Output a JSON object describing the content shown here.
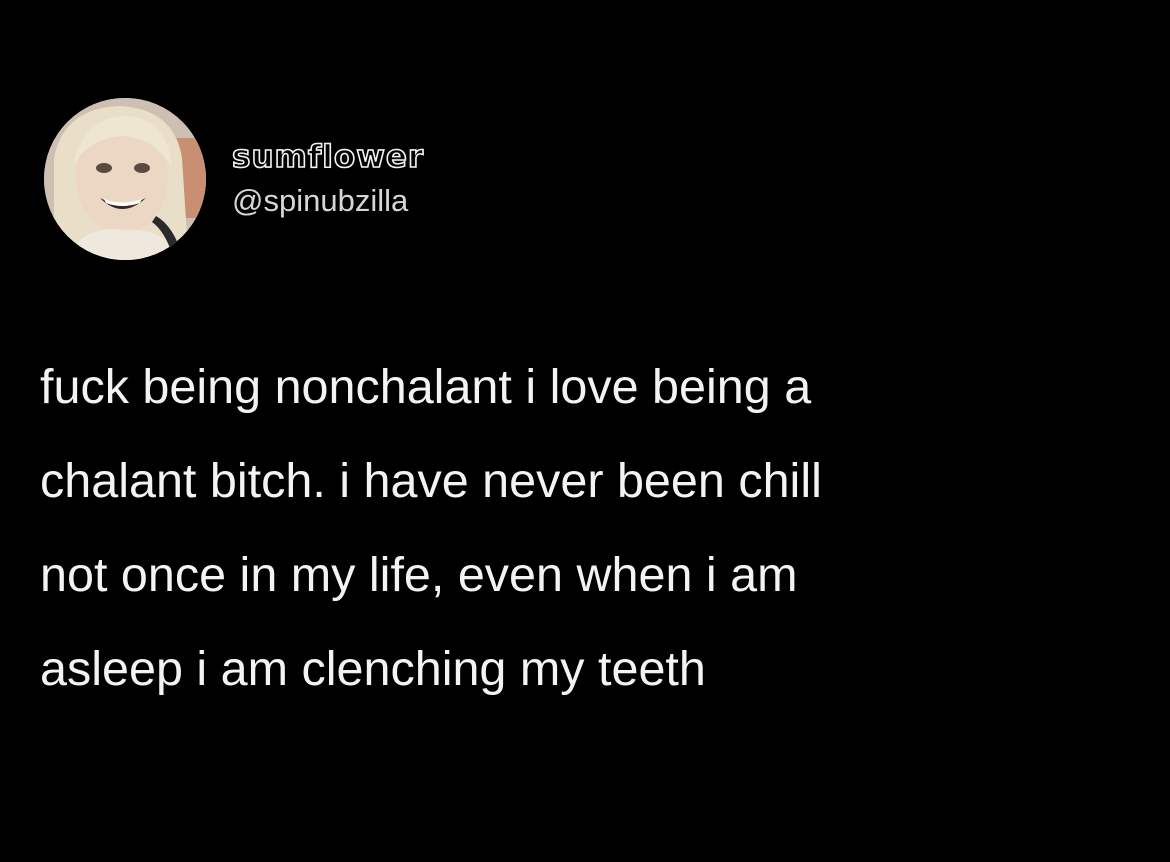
{
  "tweet": {
    "display_name": "sumflower",
    "handle": "@spinubzilla",
    "avatar_icon": "profile-photo",
    "text_lines": [
      "fuck being nonchalant i love being a",
      "chalant bitch. i have never been chill",
      "not once in my life, even when i am",
      "asleep i am clenching my teeth"
    ]
  },
  "colors": {
    "background": "#000000",
    "text": "#f3f3f3",
    "handle": "#d6d6d6"
  }
}
